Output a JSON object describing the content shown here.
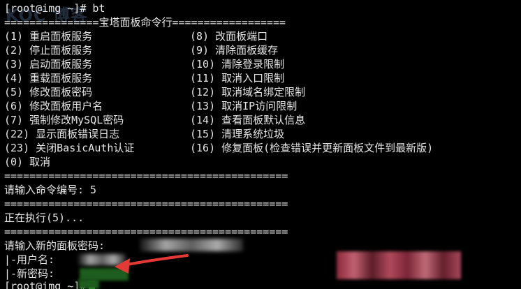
{
  "prompt_line": "[root@img ~]# bt",
  "menu_title": "===============宝塔面板命令行==================",
  "separator": "=============================================",
  "menu": {
    "left": [
      "(1) 重启面板服务",
      "(2) 停止面板服务",
      "(3) 启动面板服务",
      "(4) 重载面板服务",
      "(5) 修改面板密码",
      "(6) 修改面板用户名",
      "(7) 强制修改MySQL密码",
      "(22) 显示面板错误日志",
      "(23) 关闭BasicAuth认证",
      "(0) 取消"
    ],
    "right": [
      "(8) 改面板端口",
      "(9) 清除面板缓存",
      "(10) 清除登录限制",
      "(11) 取消入口限制",
      "(12) 取消域名绑定限制",
      "(13) 取消IP访问限制",
      "(14) 查看面板默认信息",
      "(15) 清理系统垃圾",
      "(16) 修复面板(检查错误并更新面板文件到最新版)"
    ]
  },
  "input_prompt": "请输入命令编号: 5",
  "executing": "正在执行(5)...",
  "new_password_prompt": "请输入新的面板密码:",
  "username_label": "|-用户名:",
  "password_label": "|-新密码:",
  "final_prompt": "[root@img ~]#",
  "colors": {
    "background": "#000000",
    "text": "#e6e6e6",
    "cursor": "#33cc33",
    "arrow": "#e53935"
  }
}
